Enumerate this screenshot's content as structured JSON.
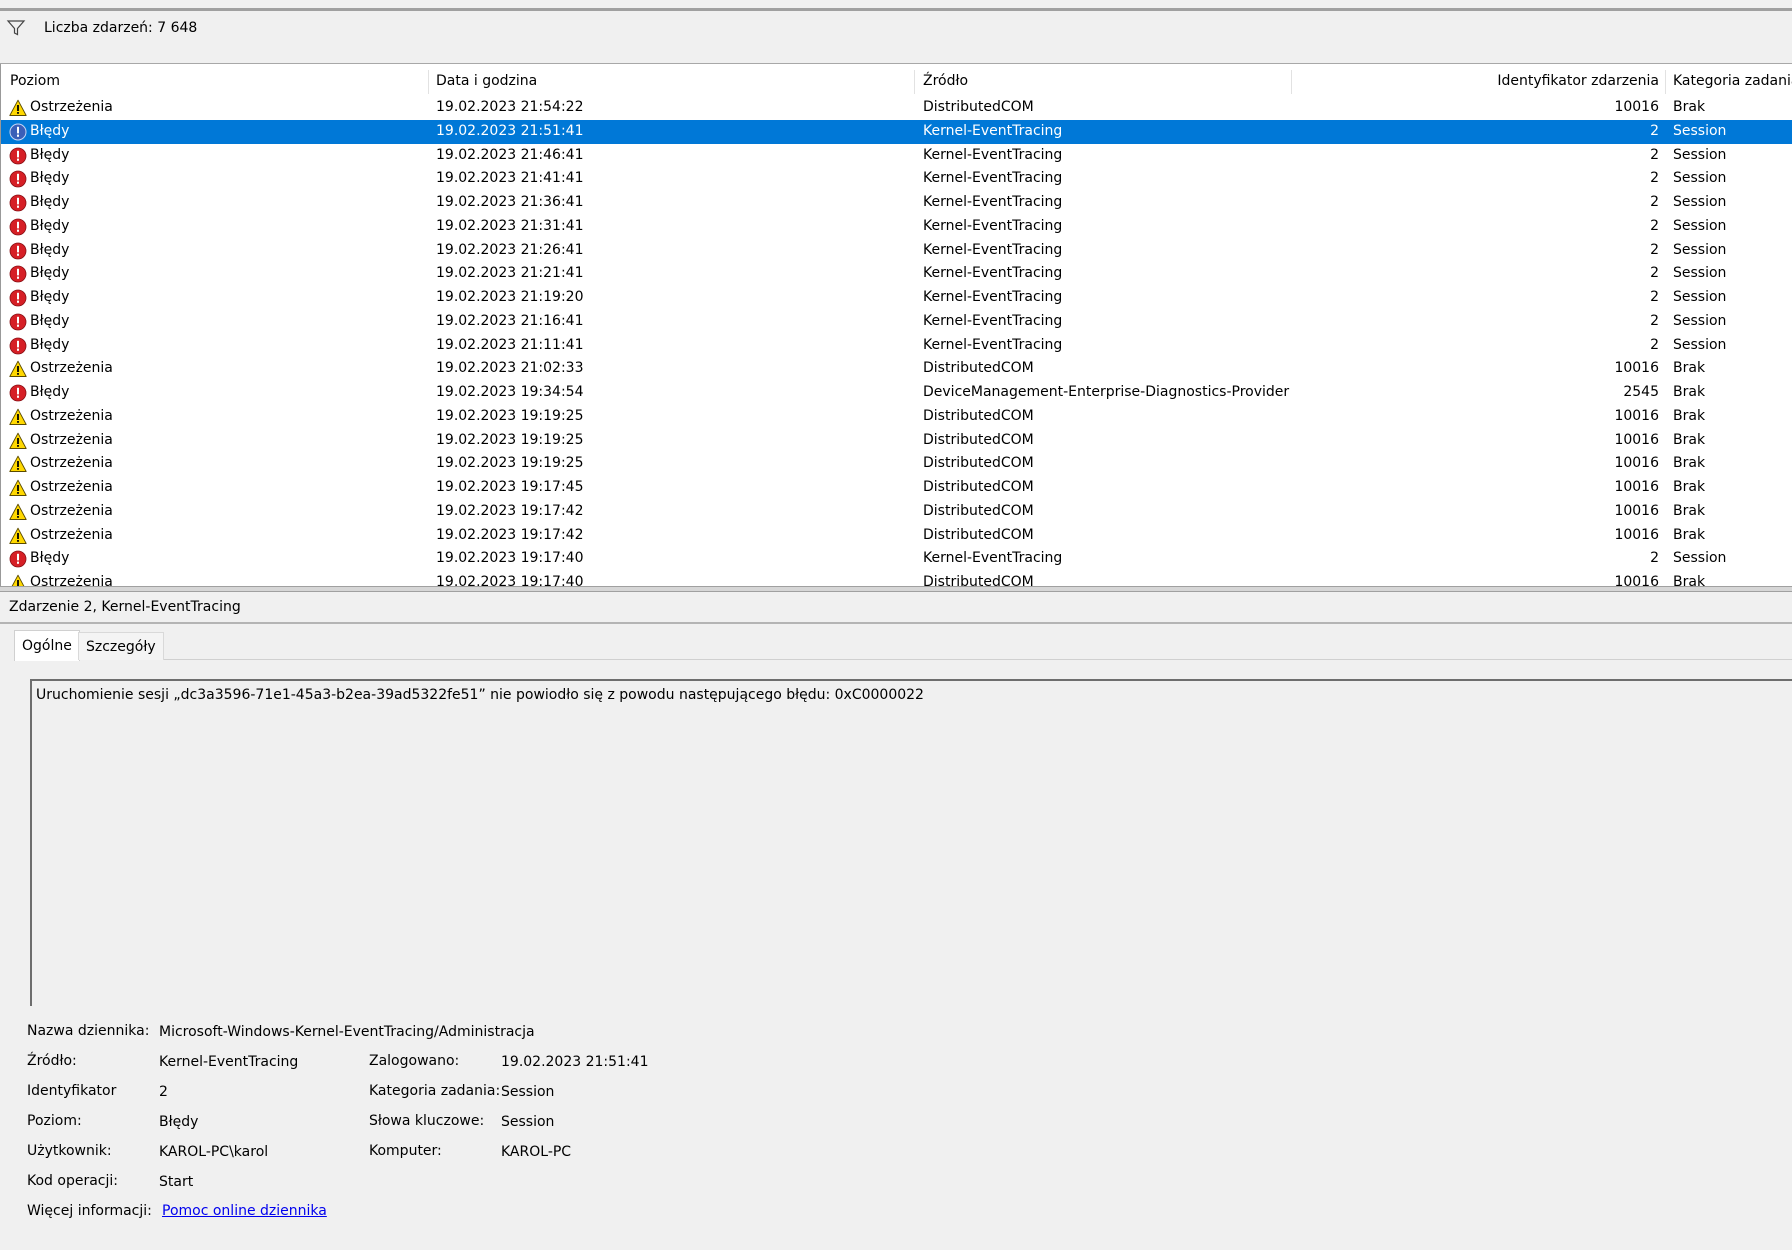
{
  "filter": {
    "icon": "filter-icon",
    "text": "Liczba zdarzeń: 7 648"
  },
  "columns": {
    "level": "Poziom",
    "date": "Data i godzina",
    "source": "Źródło",
    "id": "Identyfikator zdarzenia",
    "category": "Kategoria zadania"
  },
  "rows": [
    {
      "type": "warning",
      "level": "Ostrzeżenia",
      "date": "19.02.2023 21:54:22",
      "source": "DistributedCOM",
      "id": "10016",
      "category": "Brak",
      "selected": false
    },
    {
      "type": "error",
      "level": "Błędy",
      "date": "19.02.2023 21:51:41",
      "source": "Kernel-EventTracing",
      "id": "2",
      "category": "Session",
      "selected": true
    },
    {
      "type": "error",
      "level": "Błędy",
      "date": "19.02.2023 21:46:41",
      "source": "Kernel-EventTracing",
      "id": "2",
      "category": "Session",
      "selected": false
    },
    {
      "type": "error",
      "level": "Błędy",
      "date": "19.02.2023 21:41:41",
      "source": "Kernel-EventTracing",
      "id": "2",
      "category": "Session",
      "selected": false
    },
    {
      "type": "error",
      "level": "Błędy",
      "date": "19.02.2023 21:36:41",
      "source": "Kernel-EventTracing",
      "id": "2",
      "category": "Session",
      "selected": false
    },
    {
      "type": "error",
      "level": "Błędy",
      "date": "19.02.2023 21:31:41",
      "source": "Kernel-EventTracing",
      "id": "2",
      "category": "Session",
      "selected": false
    },
    {
      "type": "error",
      "level": "Błędy",
      "date": "19.02.2023 21:26:41",
      "source": "Kernel-EventTracing",
      "id": "2",
      "category": "Session",
      "selected": false
    },
    {
      "type": "error",
      "level": "Błędy",
      "date": "19.02.2023 21:21:41",
      "source": "Kernel-EventTracing",
      "id": "2",
      "category": "Session",
      "selected": false
    },
    {
      "type": "error",
      "level": "Błędy",
      "date": "19.02.2023 21:19:20",
      "source": "Kernel-EventTracing",
      "id": "2",
      "category": "Session",
      "selected": false
    },
    {
      "type": "error",
      "level": "Błędy",
      "date": "19.02.2023 21:16:41",
      "source": "Kernel-EventTracing",
      "id": "2",
      "category": "Session",
      "selected": false
    },
    {
      "type": "error",
      "level": "Błędy",
      "date": "19.02.2023 21:11:41",
      "source": "Kernel-EventTracing",
      "id": "2",
      "category": "Session",
      "selected": false
    },
    {
      "type": "warning",
      "level": "Ostrzeżenia",
      "date": "19.02.2023 21:02:33",
      "source": "DistributedCOM",
      "id": "10016",
      "category": "Brak",
      "selected": false
    },
    {
      "type": "error",
      "level": "Błędy",
      "date": "19.02.2023 19:34:54",
      "source": "DeviceManagement-Enterprise-Diagnostics-Provider",
      "id": "2545",
      "category": "Brak",
      "selected": false
    },
    {
      "type": "warning",
      "level": "Ostrzeżenia",
      "date": "19.02.2023 19:19:25",
      "source": "DistributedCOM",
      "id": "10016",
      "category": "Brak",
      "selected": false
    },
    {
      "type": "warning",
      "level": "Ostrzeżenia",
      "date": "19.02.2023 19:19:25",
      "source": "DistributedCOM",
      "id": "10016",
      "category": "Brak",
      "selected": false
    },
    {
      "type": "warning",
      "level": "Ostrzeżenia",
      "date": "19.02.2023 19:19:25",
      "source": "DistributedCOM",
      "id": "10016",
      "category": "Brak",
      "selected": false
    },
    {
      "type": "warning",
      "level": "Ostrzeżenia",
      "date": "19.02.2023 19:17:45",
      "source": "DistributedCOM",
      "id": "10016",
      "category": "Brak",
      "selected": false
    },
    {
      "type": "warning",
      "level": "Ostrzeżenia",
      "date": "19.02.2023 19:17:42",
      "source": "DistributedCOM",
      "id": "10016",
      "category": "Brak",
      "selected": false
    },
    {
      "type": "warning",
      "level": "Ostrzeżenia",
      "date": "19.02.2023 19:17:42",
      "source": "DistributedCOM",
      "id": "10016",
      "category": "Brak",
      "selected": false
    },
    {
      "type": "error",
      "level": "Błędy",
      "date": "19.02.2023 19:17:40",
      "source": "Kernel-EventTracing",
      "id": "2",
      "category": "Session",
      "selected": false
    },
    {
      "type": "warning",
      "level": "Ostrzeżenia",
      "date": "19.02.2023 19:17:40",
      "source": "DistributedCOM",
      "id": "10016",
      "category": "Brak",
      "selected": false
    }
  ],
  "detail": {
    "title": "Zdarzenie 2, Kernel-EventTracing",
    "tabs": {
      "general": "Ogólne",
      "details": "Szczegóły"
    },
    "message": "Uruchomienie sesji „dc3a3596-71e1-45a3-b2ea-39ad5322fe51” nie powiodło się z powodu następującego błędu: 0xC0000022",
    "labels": {
      "log_name": "Nazwa dziennika:",
      "source": "Źródło:",
      "id": "Identyfikator",
      "level": "Poziom:",
      "user": "Użytkownik:",
      "opcode": "Kod operacji:",
      "more_info": "Więcej informacji:",
      "logged": "Zalogowano:",
      "task_category": "Kategoria zadania:",
      "keywords": "Słowa kluczowe:",
      "computer": "Komputer:"
    },
    "values": {
      "log_name": "Microsoft-Windows-Kernel-EventTracing/Administracja",
      "source": "Kernel-EventTracing",
      "id": "2",
      "level": "Błędy",
      "user": "KAROL-PC\\karol",
      "opcode": "Start",
      "more_info_link": "Pomoc online dziennika",
      "logged": "19.02.2023 21:51:41",
      "task_category": "Session",
      "keywords": "Session",
      "computer": "KAROL-PC"
    }
  },
  "icons": {
    "warning": "warning-icon",
    "error": "error-icon"
  },
  "colors": {
    "selection": "#0078d7",
    "warning": "#ffd800",
    "error": "#d61f26",
    "link": "#0000ee"
  }
}
